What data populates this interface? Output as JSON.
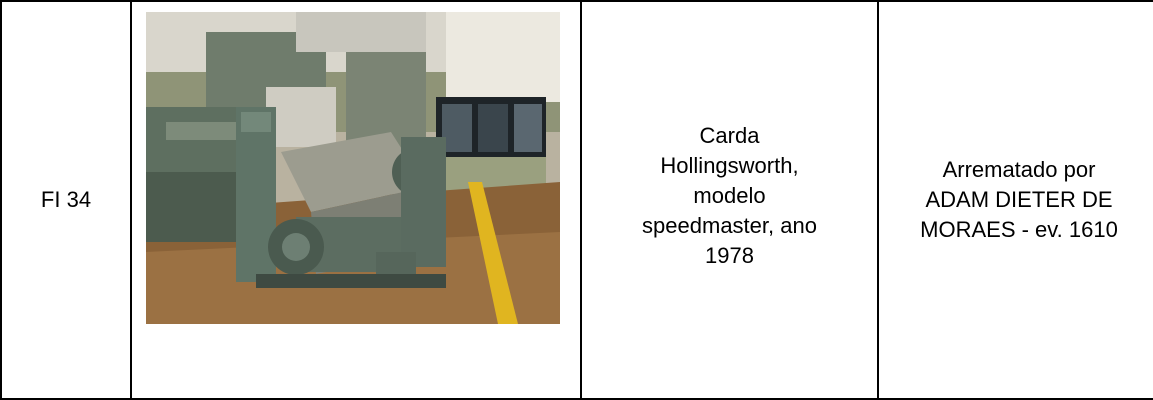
{
  "row": {
    "code": "FI 34",
    "photo": {
      "subject": "carding-machine-photo"
    },
    "description_lines": [
      "Carda",
      "Hollingsworth,",
      "modelo",
      "speedmaster, ano",
      "1978"
    ],
    "buyer_lines": [
      "Arrematado por",
      "ADAM DIETER DE",
      "MORAES - ev. 1610"
    ]
  }
}
